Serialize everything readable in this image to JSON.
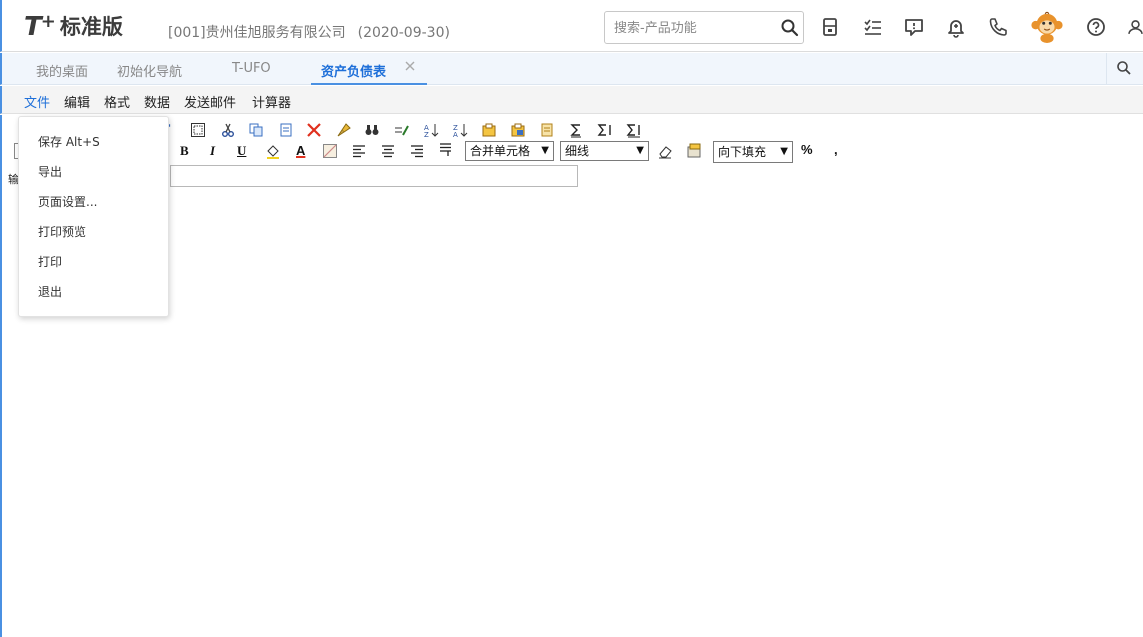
{
  "header": {
    "logo_t": "T",
    "logo_plus": "+",
    "logo_text": "标准版",
    "company": "[001]贵州佳旭服务有限公司",
    "date": "(2020-09-30)",
    "search_placeholder": "搜索-产品功能"
  },
  "tabs": [
    {
      "label": "我的桌面"
    },
    {
      "label": "初始化导航"
    },
    {
      "label": "T-UFO"
    },
    {
      "label": "资产负债表",
      "active": true
    }
  ],
  "menubar": {
    "items": [
      "文件",
      "编辑",
      "格式",
      "数据",
      "发送邮件",
      "计算器"
    ]
  },
  "file_menu": {
    "items": [
      "保存 Alt+S",
      "导出",
      "页面设置...",
      "打印预览",
      "打印",
      "退出"
    ]
  },
  "toolbar": {
    "bold": "B",
    "italic": "I",
    "underline": "U",
    "font_color": "A",
    "merge_select": "合并单元格",
    "line_select": "细线",
    "fill_select": "向下填充",
    "percent": "%",
    "comma": ","
  },
  "left_stub": "输"
}
